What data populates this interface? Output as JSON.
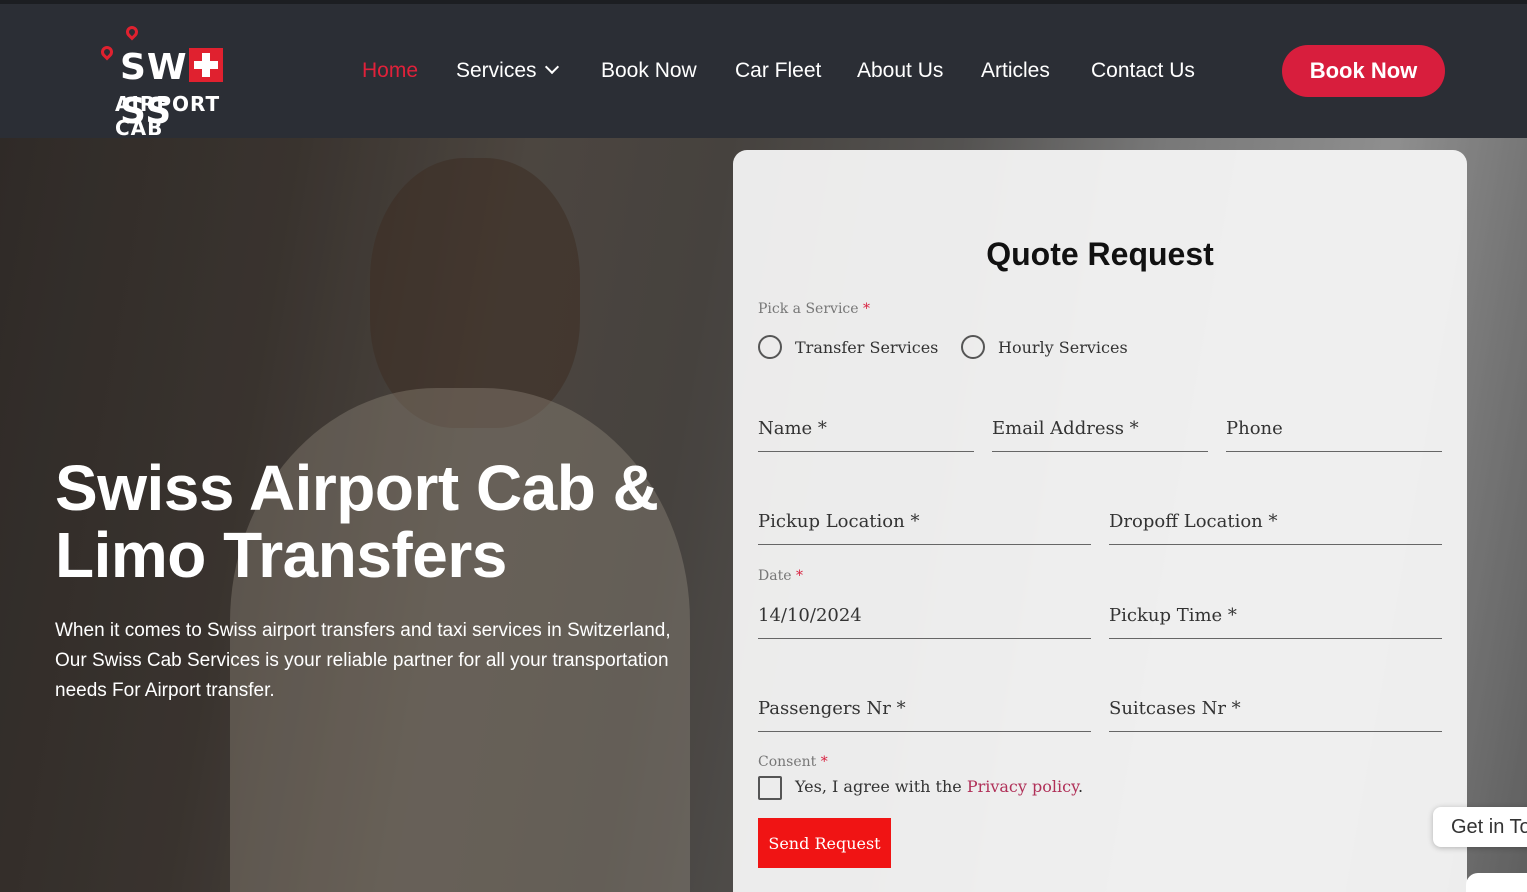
{
  "brand": {
    "logo_top": "SW",
    "logo_top_end": "SS",
    "logo_bottom": "AIRPORT CAB",
    "accent": "#d81e3d"
  },
  "nav": {
    "items": [
      {
        "label": "Home",
        "active": true
      },
      {
        "label": "Services",
        "has_dropdown": true
      },
      {
        "label": "Book Now"
      },
      {
        "label": "Car Fleet"
      },
      {
        "label": "About Us"
      },
      {
        "label": "Articles"
      },
      {
        "label": "Contact Us"
      }
    ],
    "cta_label": "Book Now"
  },
  "hero": {
    "title": "Swiss Airport Cab & Limo Transfers",
    "description": "When it comes to Swiss airport transfers and taxi services in Switzerland, Our Swiss Cab Services is your reliable partner for all your transportation needs For Airport transfer."
  },
  "form": {
    "title": "Quote Request",
    "service_label": "Pick a Service",
    "required_mark": "*",
    "service_options": [
      "Transfer Services",
      "Hourly Services"
    ],
    "fields": {
      "name": "Name *",
      "email": "Email Address *",
      "phone": "Phone",
      "pickup_location": "Pickup Location *",
      "dropoff_location": "Dropoff Location *",
      "date_label": "Date",
      "date_value": "14/10/2024",
      "pickup_time": "Pickup Time *",
      "passengers": "Passengers Nr *",
      "suitcases": "Suitcases Nr *"
    },
    "consent_label": "Consent",
    "consent_text": "Yes, I agree with the ",
    "consent_link": "Privacy policy",
    "consent_end": ".",
    "submit_label": "Send Request"
  },
  "widget": {
    "get_in_touch": "Get in To"
  }
}
